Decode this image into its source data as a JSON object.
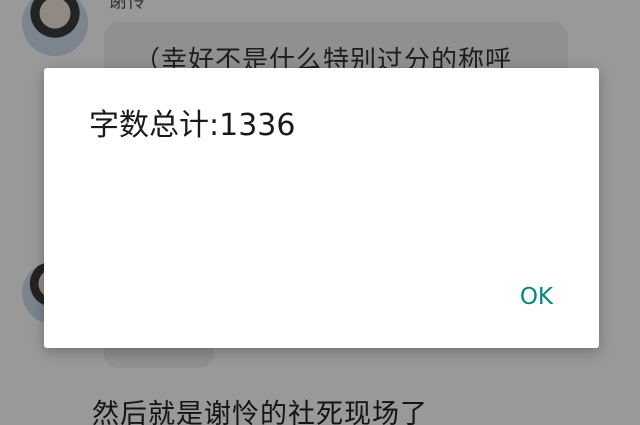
{
  "background": {
    "sender_name": "谢怜",
    "bubble_text": "（幸好不是什么特别过分的称呼",
    "bottom_text": "然后就是谢怜的社死现场了"
  },
  "dialog": {
    "message": "字数总计:1336",
    "ok_label": "OK",
    "accent_color": "#00897b"
  }
}
